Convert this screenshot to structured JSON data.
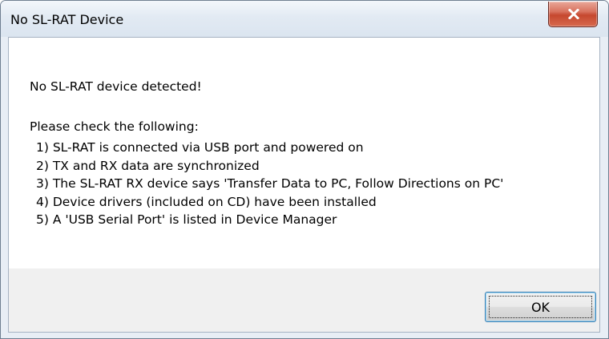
{
  "window": {
    "title": "No SL-RAT Device",
    "close_icon": "close-x-icon"
  },
  "message": {
    "heading": "No SL-RAT device detected!",
    "intro": "Please check the following:",
    "items": [
      "1) SL-RAT is connected via USB port and powered on",
      "2) TX and RX data are synchronized",
      "3) The SL-RAT RX device says 'Transfer Data to PC, Follow Directions on PC'",
      "4) Device drivers (included on CD) have been installed",
      "5) A 'USB Serial Port' is listed in Device Manager"
    ]
  },
  "buttons": {
    "ok_label": "OK"
  },
  "colors": {
    "close_button": "#c6482f",
    "content_background": "#ffffff",
    "footer_background": "#f0f0f0",
    "frame": "#dbe5f0",
    "button_border": "#3c7fb1"
  }
}
